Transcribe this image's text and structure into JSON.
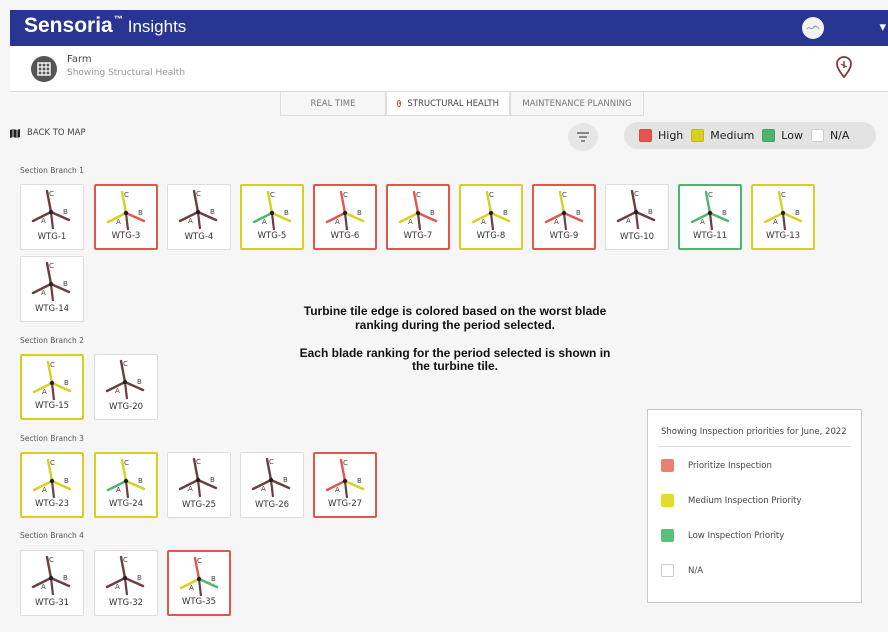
{
  "header": {
    "brand": "Sensoria",
    "trademark": "™",
    "product": "Insights"
  },
  "subheader": {
    "title": "Farm",
    "subtitle": "Showing Structural Health"
  },
  "tabs": [
    {
      "label": "REAL TIME",
      "active": false
    },
    {
      "label": "STRUCTURAL HEALTH",
      "active": true
    },
    {
      "label": "MAINTENANCE PLANNING",
      "active": false
    }
  ],
  "back_label": "BACK TO MAP",
  "legend": [
    {
      "label": "High",
      "color": "#e4564c"
    },
    {
      "label": "Medium",
      "color": "#d8d020"
    },
    {
      "label": "Low",
      "color": "#4fb56e"
    },
    {
      "label": "N/A",
      "color": "#ffffff"
    }
  ],
  "blade_labels": {
    "a": "A",
    "b": "B",
    "c": "C"
  },
  "colors": {
    "high": "#e4564c",
    "medium": "#d8d020",
    "low": "#4fb56e",
    "na": "#6b3f3f"
  },
  "sections": [
    {
      "label": "Section Branch 1",
      "turbines": [
        {
          "name": "WTG-1",
          "rank": "na",
          "blades": [
            "na",
            "na",
            "na"
          ]
        },
        {
          "name": "WTG-3",
          "rank": "high",
          "blades": [
            "medium",
            "high",
            "medium"
          ]
        },
        {
          "name": "WTG-4",
          "rank": "na",
          "blades": [
            "na",
            "na",
            "na"
          ]
        },
        {
          "name": "WTG-5",
          "rank": "medium",
          "blades": [
            "low",
            "medium",
            "medium"
          ]
        },
        {
          "name": "WTG-6",
          "rank": "high",
          "blades": [
            "high",
            "medium",
            "high"
          ]
        },
        {
          "name": "WTG-7",
          "rank": "high",
          "blades": [
            "medium",
            "high",
            "high"
          ]
        },
        {
          "name": "WTG-8",
          "rank": "medium",
          "blades": [
            "medium",
            "medium",
            "medium"
          ]
        },
        {
          "name": "WTG-9",
          "rank": "high",
          "blades": [
            "high",
            "high",
            "medium"
          ]
        },
        {
          "name": "WTG-10",
          "rank": "na",
          "blades": [
            "na",
            "na",
            "na"
          ]
        },
        {
          "name": "WTG-11",
          "rank": "low",
          "blades": [
            "low",
            "low",
            "low"
          ]
        },
        {
          "name": "WTG-13",
          "rank": "medium",
          "blades": [
            "medium",
            "medium",
            "medium"
          ]
        },
        {
          "name": "WTG-14",
          "rank": "na",
          "blades": [
            "na",
            "na",
            "na"
          ]
        }
      ]
    },
    {
      "label": "Section Branch 2",
      "turbines": [
        {
          "name": "WTG-15",
          "rank": "medium",
          "blades": [
            "medium",
            "medium",
            "medium"
          ]
        },
        {
          "name": "WTG-20",
          "rank": "na",
          "blades": [
            "na",
            "na",
            "na"
          ]
        }
      ]
    },
    {
      "label": "Section Branch 3",
      "turbines": [
        {
          "name": "WTG-23",
          "rank": "medium",
          "blades": [
            "medium",
            "medium",
            "medium"
          ]
        },
        {
          "name": "WTG-24",
          "rank": "medium",
          "blades": [
            "low",
            "medium",
            "medium"
          ]
        },
        {
          "name": "WTG-25",
          "rank": "na",
          "blades": [
            "na",
            "na",
            "na"
          ]
        },
        {
          "name": "WTG-26",
          "rank": "na",
          "blades": [
            "na",
            "na",
            "na"
          ]
        },
        {
          "name": "WTG-27",
          "rank": "high",
          "blades": [
            "high",
            "medium",
            "high"
          ]
        }
      ]
    },
    {
      "label": "Section Branch 4",
      "turbines": [
        {
          "name": "WTG-31",
          "rank": "na",
          "blades": [
            "na",
            "na",
            "na"
          ]
        },
        {
          "name": "WTG-32",
          "rank": "na",
          "blades": [
            "na",
            "na",
            "na"
          ]
        },
        {
          "name": "WTG-35",
          "rank": "high",
          "blades": [
            "medium",
            "low",
            "high"
          ]
        }
      ]
    }
  ],
  "note": {
    "line1": "Turbine tile edge is colored based on the worst blade ranking during the period selected.",
    "line2": "Each blade ranking for the period selected is shown in the turbine tile."
  },
  "info_panel": {
    "title": "Showing Inspection priorities for June, 2022",
    "items": [
      {
        "label": "Prioritize Inspection",
        "color": "#e98070"
      },
      {
        "label": "Medium Inspection Priority",
        "color": "#e2dc2c"
      },
      {
        "label": "Low Inspection Priority",
        "color": "#5bbe7a"
      },
      {
        "label": "N/A",
        "color": "#ffffff"
      }
    ]
  }
}
